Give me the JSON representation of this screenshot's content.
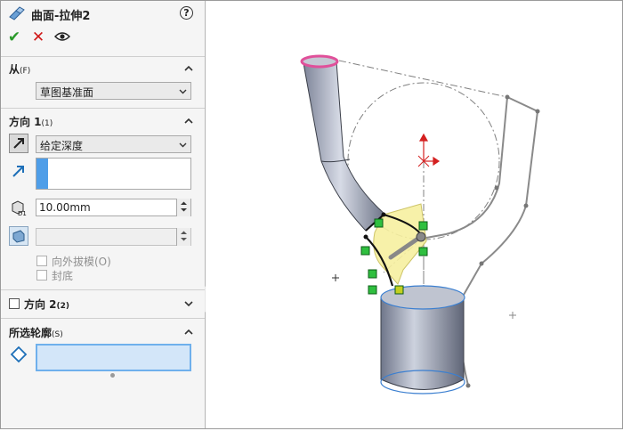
{
  "panel": {
    "title": "曲面-拉伸2",
    "help_label": "?",
    "actions": {
      "ok_glyph": "✔",
      "cancel_glyph": "✕"
    },
    "from": {
      "title": "从",
      "suffix": "(F)",
      "selected": "草图基准面"
    },
    "direction1": {
      "title": "方向 1",
      "suffix": "(1)",
      "end_condition": "给定深度",
      "depth": "10.00mm",
      "draft_outward_label": "向外拔模(O)",
      "cap_end_label": "封底"
    },
    "direction2": {
      "title": "方向 2",
      "suffix": "(2)"
    },
    "contours": {
      "title": "所选轮廓",
      "suffix": "(S)"
    }
  },
  "colors": {
    "accent_blue": "#4f9ee8",
    "ok_green": "#2a9a2a",
    "cancel_red": "#d01818",
    "selection_pink": "#e0509a",
    "preview_yellow": "#f7f0a0"
  }
}
